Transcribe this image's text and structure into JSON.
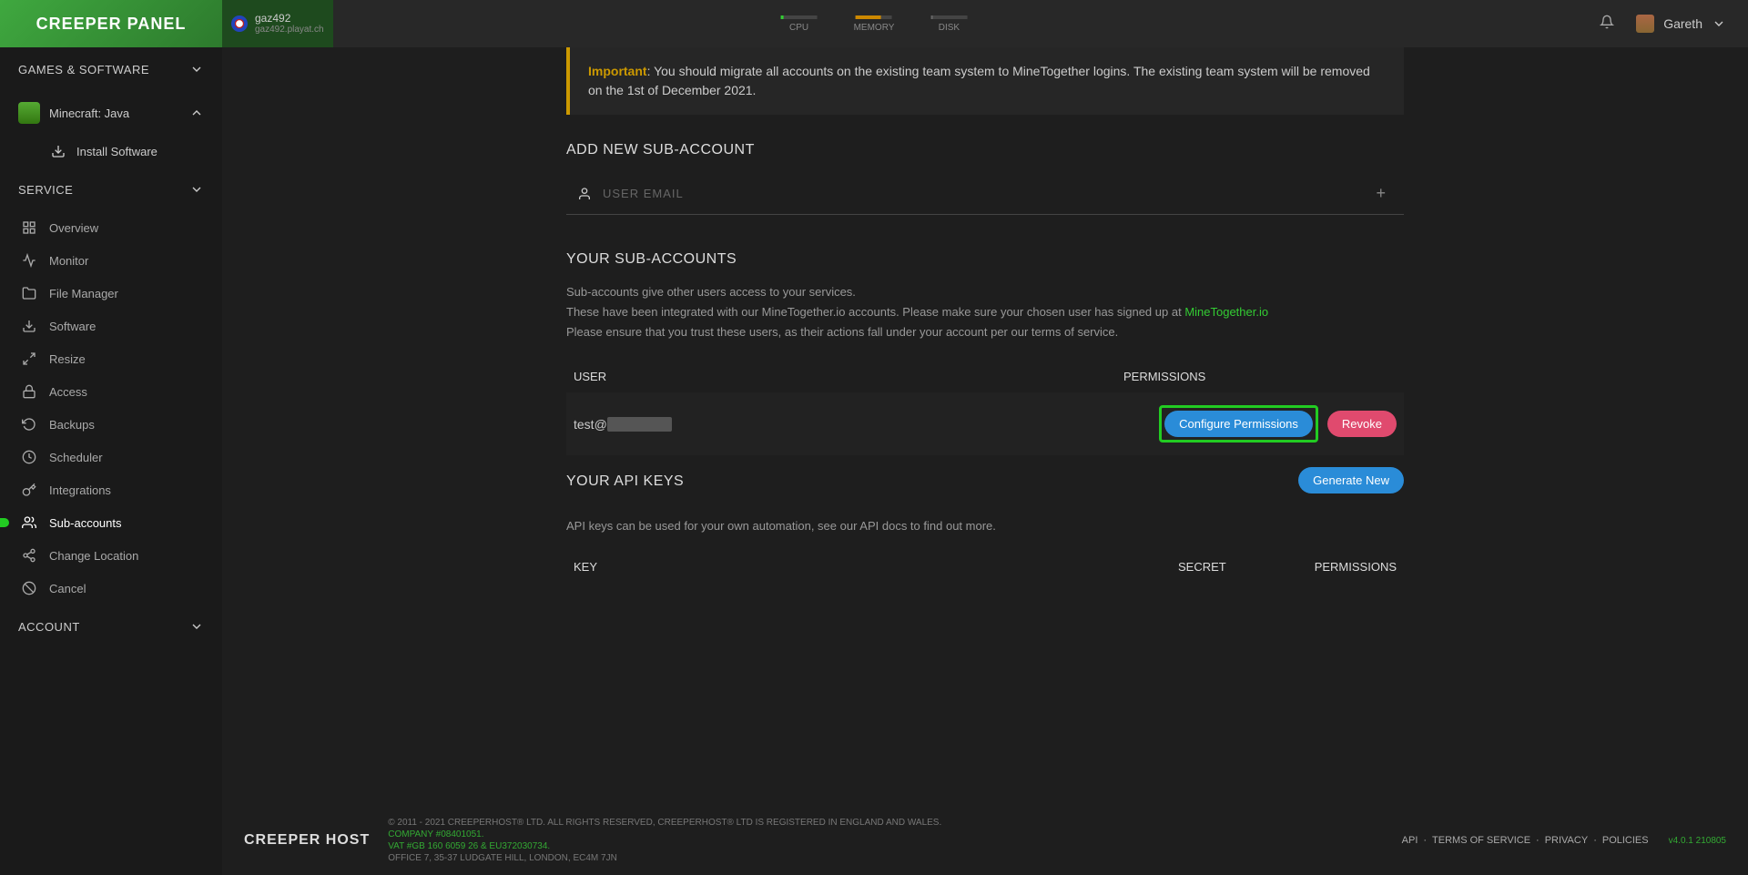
{
  "logo": "CREEPER PANEL",
  "server": {
    "name": "gaz492",
    "host": "gaz492.playat.ch"
  },
  "gauges": {
    "cpu": "CPU",
    "mem": "MEMORY",
    "disk": "DISK"
  },
  "user": {
    "name": "Gareth"
  },
  "sidebar": {
    "sections": {
      "games": "GAMES & SOFTWARE",
      "service": "SERVICE",
      "account": "ACCOUNT"
    },
    "game": "Minecraft: Java",
    "install": "Install Software",
    "nav": {
      "overview": "Overview",
      "monitor": "Monitor",
      "fileManager": "File Manager",
      "software": "Software",
      "resize": "Resize",
      "access": "Access",
      "backups": "Backups",
      "scheduler": "Scheduler",
      "integrations": "Integrations",
      "subAccounts": "Sub-accounts",
      "changeLocation": "Change Location",
      "cancel": "Cancel"
    }
  },
  "content": {
    "callout": {
      "label": "Important",
      "text": ": You should migrate all accounts on the existing team system to MineTogether logins. The existing team system will be removed on the 1st of December 2021."
    },
    "addTitle": "ADD NEW SUB-ACCOUNT",
    "emailPlaceholder": "USER EMAIL",
    "yourSubTitle": "YOUR SUB-ACCOUNTS",
    "desc1": "Sub-accounts give other users access to your services.",
    "desc2a": "These have been integrated with our MineTogether.io accounts. Please make sure your chosen user has signed up at ",
    "desc2link": "MineTogether.io",
    "desc3": "Please ensure that you trust these users, as their actions fall under your account per our terms of service.",
    "cols": {
      "user": "USER",
      "perm": "PERMISSIONS"
    },
    "row": {
      "email": "test@",
      "configureBtn": "Configure Permissions",
      "revokeBtn": "Revoke"
    },
    "apiTitle": "YOUR API KEYS",
    "generateBtn": "Generate New",
    "apiDesc": "API keys can be used for your own automation, see our API docs to find out more.",
    "apiCols": {
      "key": "KEY",
      "secret": "SECRET",
      "perm": "PERMISSIONS"
    }
  },
  "footer": {
    "logo": "CREEPER HOST",
    "line1": "© 2011 - 2021 CREEPERHOST® LTD. ALL RIGHTS RESERVED, CREEPERHOST® LTD IS REGISTERED IN ENGLAND AND WALES.",
    "line2": "COMPANY #08401051.",
    "line3": "VAT #GB 160 6059 26 & EU372030734.",
    "line4": "OFFICE 7, 35-37 LUDGATE HILL, LONDON, EC4M 7JN",
    "links": {
      "api": "API",
      "tos": "TERMS OF SERVICE",
      "privacy": "PRIVACY",
      "policies": "POLICIES"
    },
    "version": "v4.0.1 210805"
  }
}
